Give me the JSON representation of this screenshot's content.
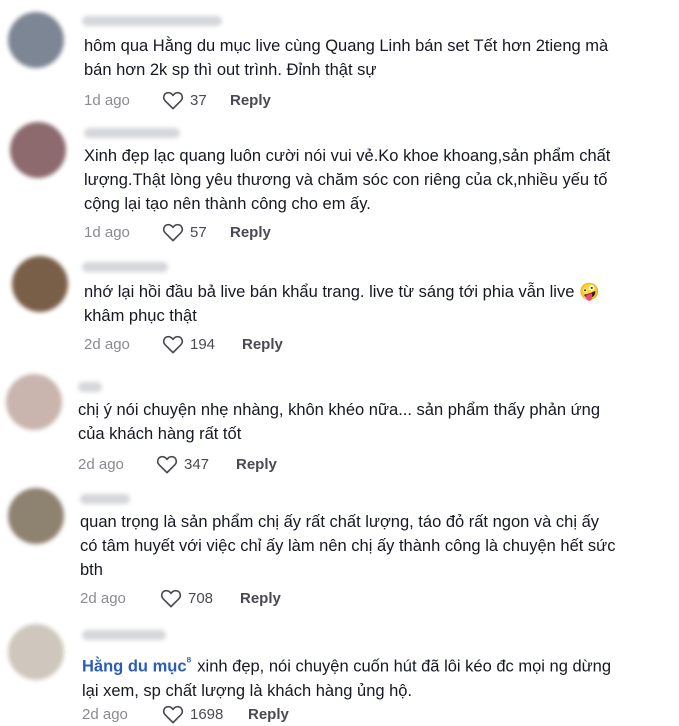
{
  "comments": [
    {
      "text_lines": [
        "hôm qua Hằng du mục live cùng Quang Linh bán set Tết hơn 2tieng mà",
        "bán hơn 2k sp thì out trình. Đỉnh thật sự"
      ],
      "date": "1d ago",
      "likes": "37",
      "reply": "Reply",
      "avatar_color": "#7d8694"
    },
    {
      "text_lines": [
        "Xinh đẹp lạc quang luôn cười nói vui vẻ.Ko khoe khoang,sản phẩm chất",
        "lượng.Thật lòng yêu thương và chăm sóc con riêng của ck,nhiều yếu tố",
        "cộng lại tạo nên thành công cho em ấy."
      ],
      "date": "1d ago",
      "likes": "57",
      "reply": "Reply",
      "avatar_color": "#8c6a6e"
    },
    {
      "text_lines": [
        "nhớ lại hồi đầu bả live bán khẩu trang. live từ sáng tới phia vẫn live 🤪",
        "khâm phục thật"
      ],
      "date": "2d ago",
      "likes": "194",
      "reply": "Reply",
      "avatar_color": "#7a5f48"
    },
    {
      "text_lines": [
        "chị ý nói chuyện nhẹ nhàng, khôn khéo nữa... sản phẩm thấy phản ứng",
        "của khách hàng rất tốt"
      ],
      "date": "2d ago",
      "likes": "347",
      "reply": "Reply",
      "avatar_color": "#c9b5ad"
    },
    {
      "text_lines": [
        "quan trọng là sản phẩm chị ấy rất chất lượng, táo đỏ rất ngon và chị ấy",
        "có tâm huyết với việc chỉ ấy làm nên chị ấy thành công là chuyện hết sức",
        "bth"
      ],
      "date": "2d ago",
      "likes": "708",
      "reply": "Reply",
      "avatar_color": "#8e8270"
    },
    {
      "mention": "Hằng du mục",
      "mention_icon": "ᴽ",
      "text_lines": [
        "xinh đẹp, nói chuyện cuốn hút đã lôi kéo đc mọi ng dừng",
        "lại xem, sp chất lượng là khách hàng ủng hộ."
      ],
      "date": "2d ago",
      "likes": "1698",
      "reply": "Reply",
      "avatar_color": "#cfc7bd"
    }
  ],
  "icons": {
    "like": "heart-outline-icon"
  }
}
